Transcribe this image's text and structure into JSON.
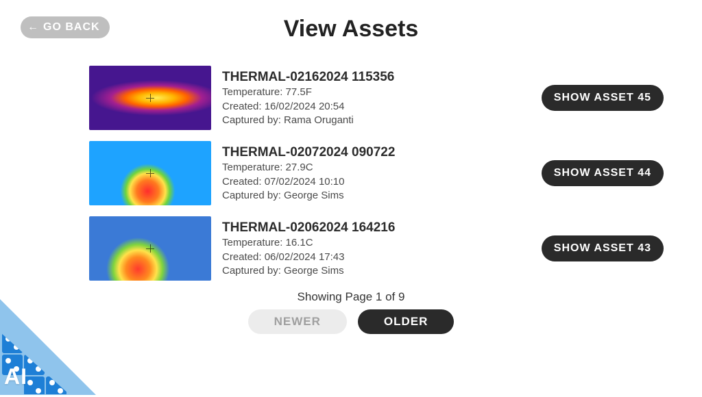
{
  "header": {
    "back_label": "GO BACK",
    "title": "View Assets"
  },
  "assets": [
    {
      "title": "THERMAL-02162024 115356",
      "temperature_line": "Temperature: 77.5F",
      "created_line": "Created: 16/02/2024 20:54",
      "captured_line": "Captured by: Rama Oruganti",
      "show_label": "SHOW ASSET 45"
    },
    {
      "title": "THERMAL-02072024 090722",
      "temperature_line": "Temperature: 27.9C",
      "created_line": "Created: 07/02/2024 10:10",
      "captured_line": "Captured by: George Sims",
      "show_label": "SHOW ASSET 44"
    },
    {
      "title": "THERMAL-02062024 164216",
      "temperature_line": "Temperature: 16.1C",
      "created_line": "Created: 06/02/2024 17:43",
      "captured_line": "Captured by: George Sims",
      "show_label": "SHOW ASSET 43"
    }
  ],
  "pager": {
    "status": "Showing Page 1 of 9",
    "newer_label": "NEWER",
    "older_label": "OLDER"
  },
  "corner": {
    "ai_label": "AI"
  }
}
